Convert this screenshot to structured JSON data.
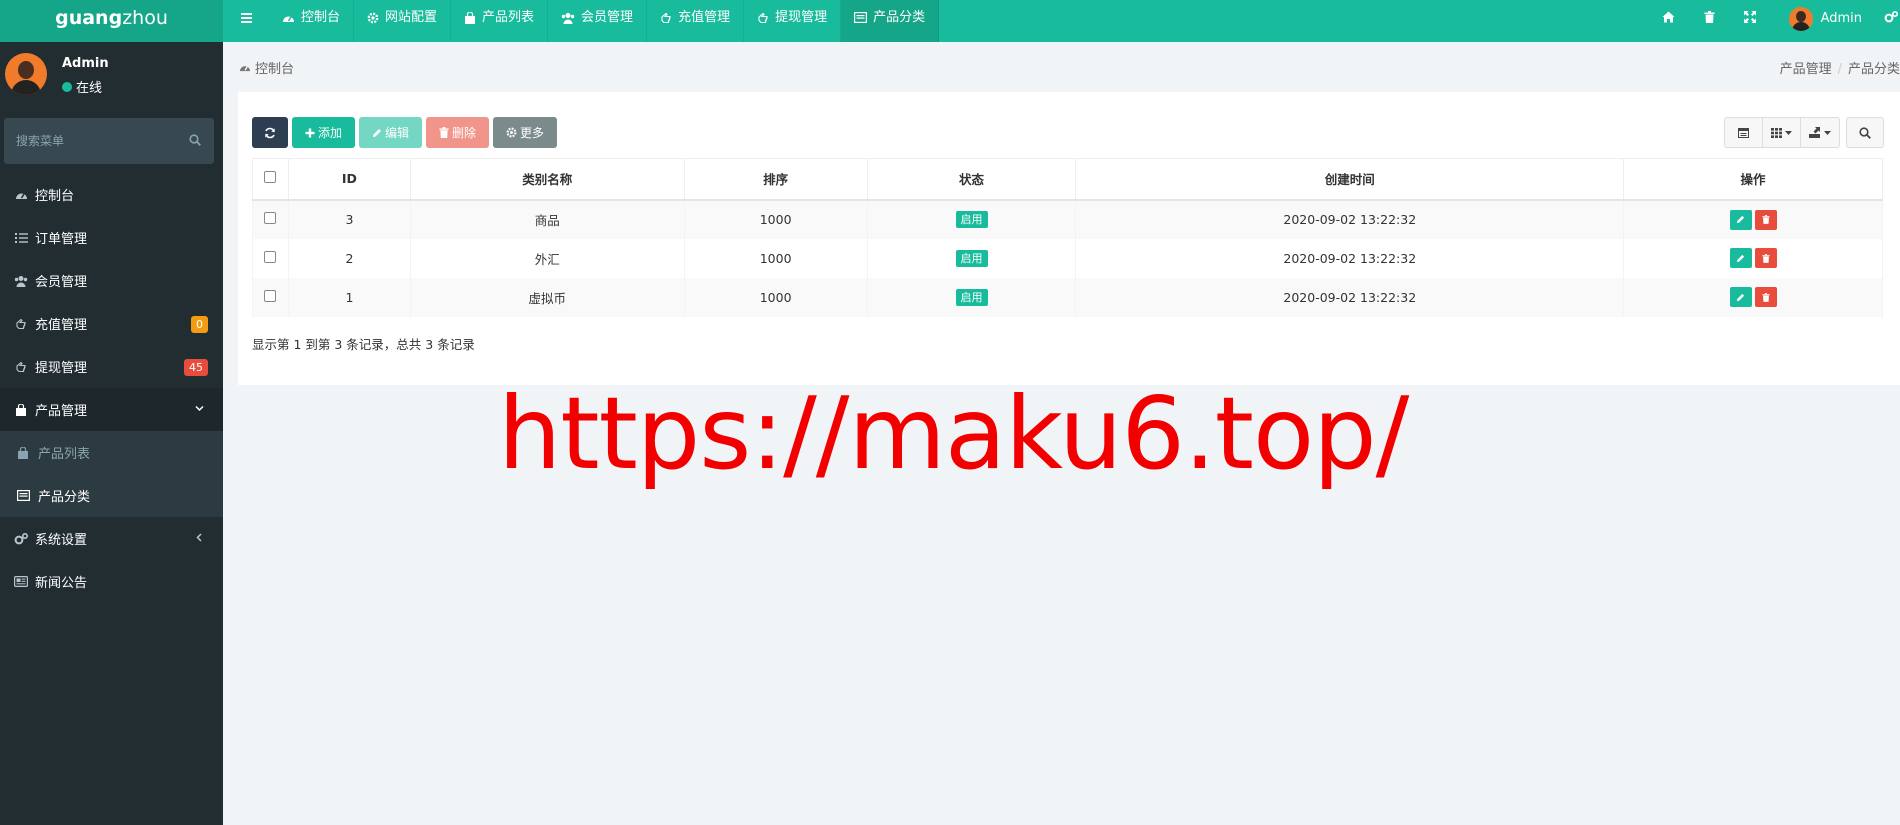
{
  "app": {
    "logo_bold": "guang",
    "logo_thin": "zhou"
  },
  "topnav": {
    "tabs": [
      {
        "label": "控制台",
        "icon": "dashboard-icon"
      },
      {
        "label": "网站配置",
        "icon": "gear-icon"
      },
      {
        "label": "产品列表",
        "icon": "shopping-bag-icon"
      },
      {
        "label": "会员管理",
        "icon": "users-icon"
      },
      {
        "label": "充值管理",
        "icon": "hand-icon"
      },
      {
        "label": "提现管理",
        "icon": "hand-icon"
      },
      {
        "label": "产品分类",
        "icon": "list-icon",
        "active": true
      }
    ],
    "user_name": "Admin"
  },
  "sidebar": {
    "profile_name": "Admin",
    "profile_status": "在线",
    "search_placeholder": "搜索菜单",
    "items": [
      {
        "label": "控制台",
        "icon": "dashboard-icon"
      },
      {
        "label": "订单管理",
        "icon": "list-icon"
      },
      {
        "label": "会员管理",
        "icon": "users-icon"
      },
      {
        "label": "充值管理",
        "icon": "hand-icon",
        "badge": "0",
        "badge_color": "#f39c12"
      },
      {
        "label": "提现管理",
        "icon": "hand-icon",
        "badge": "45",
        "badge_color": "#e74c3c"
      },
      {
        "label": "产品管理",
        "icon": "shopping-bag-icon",
        "open": true
      },
      {
        "label": "系统设置",
        "icon": "cogs-icon"
      },
      {
        "label": "新闻公告",
        "icon": "newspaper-icon"
      }
    ],
    "submenu": [
      {
        "label": "产品列表",
        "icon": "shopping-bag-icon"
      },
      {
        "label": "产品分类",
        "icon": "list-icon",
        "active": true
      }
    ]
  },
  "header": {
    "page_title": "控制台",
    "breadcrumb": [
      "产品管理",
      "产品分类"
    ]
  },
  "toolbar": {
    "add_label": "添加",
    "edit_label": "编辑",
    "delete_label": "删除",
    "more_label": "更多"
  },
  "table": {
    "columns": [
      "ID",
      "类别名称",
      "排序",
      "状态",
      "创建时间",
      "操作"
    ],
    "rows": [
      {
        "id": "3",
        "name": "商品",
        "sort": "1000",
        "status": "启用",
        "created": "2020-09-02 13:22:32"
      },
      {
        "id": "2",
        "name": "外汇",
        "sort": "1000",
        "status": "启用",
        "created": "2020-09-02 13:22:32"
      },
      {
        "id": "1",
        "name": "虚拟币",
        "sort": "1000",
        "status": "启用",
        "created": "2020-09-02 13:22:32"
      }
    ],
    "pager_text": "显示第 1 到第 3 条记录，总共 3 条记录"
  },
  "watermark": "https://maku6.top/",
  "colors": {
    "primary": "#18bc9c",
    "sidebar_bg": "#222d32",
    "danger": "#e74c3c",
    "warning": "#f39c12"
  }
}
